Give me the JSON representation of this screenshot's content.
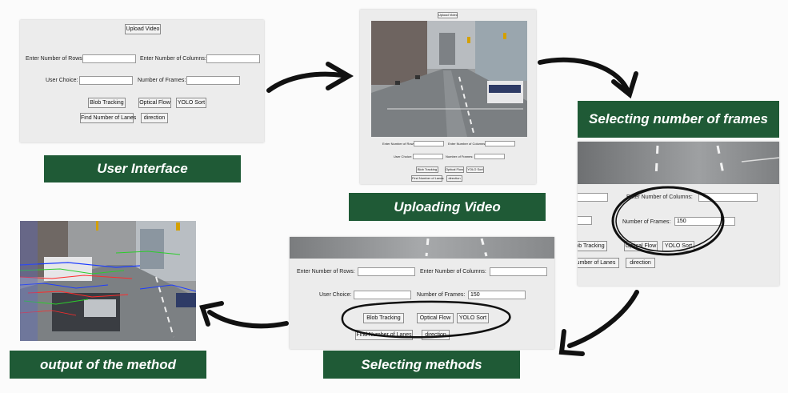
{
  "panel1": {
    "upload_button": "Upload Video",
    "rows_label": "Enter Number of Rows:",
    "columns_label": "Enter Number of Columns:",
    "user_choice_label": "User Choice:",
    "frames_label": "Number of Frames:",
    "blob_button": "Blob Tracking",
    "optical_flow_button": "Optical Flow",
    "yolo_button": "YOLO Sort",
    "find_lanes_button": "Find Number of Lanes",
    "direction_button": "direction"
  },
  "panel2": {
    "upload_button": "Upload Video",
    "rows_label": "Enter Number of Rows:",
    "columns_label": "Enter Number of Columns:",
    "user_choice_label": "User Choice:",
    "frames_label": "Number of Frames:",
    "blob_button": "Blob Tracking",
    "optical_flow_button": "Optical Flow",
    "yolo_button": "YOLO Sort",
    "find_lanes_button": "Find Number of Lanes",
    "direction_button": "direction"
  },
  "panel3": {
    "columns_label": "Enter Number of Columns:",
    "frames_label": "Number of Frames:",
    "frames_value": "150",
    "blob_button": "ob Tracking",
    "optical_flow_button": "Optical Flow",
    "yolo_button": "YOLO Sort",
    "find_lanes_button": "umber of Lanes",
    "direction_button": "direction"
  },
  "panel4": {
    "rows_label": "Enter Number of Rows:",
    "columns_label": "Enter Number of Columns:",
    "user_choice_label": "User Choice:",
    "frames_label": "Number of Frames:",
    "frames_value": "150",
    "blob_button": "Blob Tracking",
    "optical_flow_button": "Optical Flow",
    "yolo_button": "YOLO Sort",
    "find_lanes_button": "Find Number of Lanes",
    "direction_button": "direction"
  },
  "captions": {
    "user_interface": "User Interface",
    "uploading_video": "Uploading Video",
    "selecting_frames": "Selecting number of frames",
    "selecting_methods": "Selecting methods",
    "output": "output of the method"
  },
  "colors": {
    "caption_bg": "#1f5a36",
    "panel_bg": "#ececec",
    "annotation": "#111111"
  },
  "icons": [
    "curved-arrow-icon",
    "circle-annotation-icon"
  ]
}
